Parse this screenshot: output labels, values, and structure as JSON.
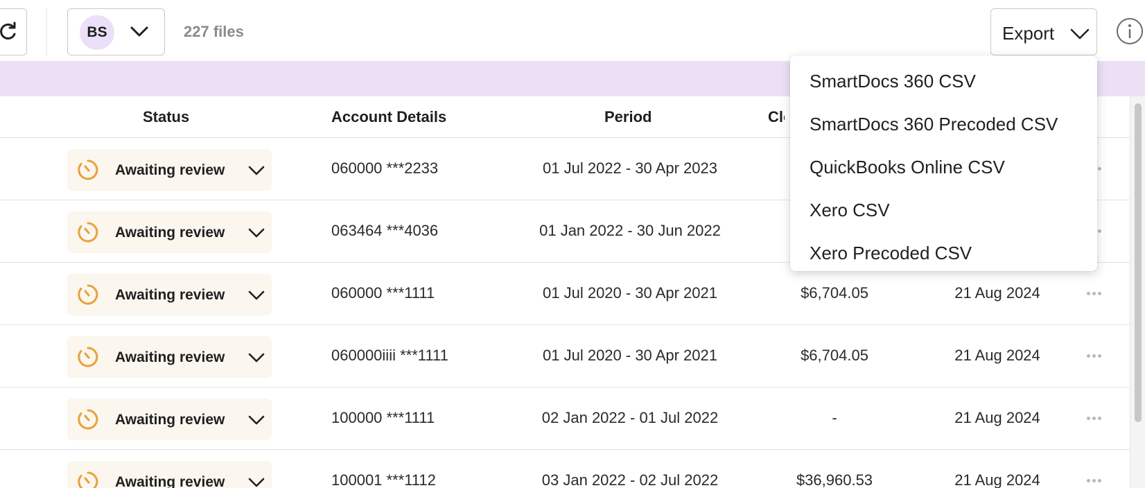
{
  "toolbar": {
    "refresh_icon": "refresh-icon",
    "user_initials": "BS",
    "file_count": "227 files",
    "export_label": "Export",
    "info_icon": "info-icon"
  },
  "table": {
    "headers": {
      "status": "Status",
      "account": "Account Details",
      "period": "Period",
      "closing": "Clo"
    },
    "rows": [
      {
        "status": "Awaiting review",
        "account": "060000 ***2233",
        "period": "01 Jul 2022 - 30 Apr 2023",
        "amount": "",
        "date": ""
      },
      {
        "status": "Awaiting review",
        "account": "063464 ***4036",
        "period": "01 Jan 2022 - 30 Jun 2022",
        "amount": "",
        "date": ""
      },
      {
        "status": "Awaiting review",
        "account": "060000 ***1111",
        "period": "01 Jul 2020 - 30 Apr 2021",
        "amount": "$6,704.05",
        "date": "21 Aug 2024"
      },
      {
        "status": "Awaiting review",
        "account": "060000iiii ***1111",
        "period": "01 Jul 2020 - 30 Apr 2021",
        "amount": "$6,704.05",
        "date": "21 Aug 2024"
      },
      {
        "status": "Awaiting review",
        "account": "100000 ***1111",
        "period": "02 Jan 2022 - 01 Jul 2022",
        "amount": "-",
        "date": "21 Aug 2024"
      },
      {
        "status": "Awaiting review",
        "account": "100001 ***1112",
        "period": "03 Jan 2022 - 02 Jul 2022",
        "amount": "$36,960.53",
        "date": "21 Aug 2024"
      }
    ]
  },
  "export_menu": {
    "items": [
      "SmartDocs 360 CSV",
      "SmartDocs 360 Precoded CSV",
      "QuickBooks Online CSV",
      "Xero CSV",
      "Xero Precoded CSV"
    ]
  },
  "colors": {
    "banner": "#ece0f7",
    "avatar": "#ece0f9",
    "status_pill": "#fbf6ee",
    "status_icon": "#e8a13a"
  }
}
